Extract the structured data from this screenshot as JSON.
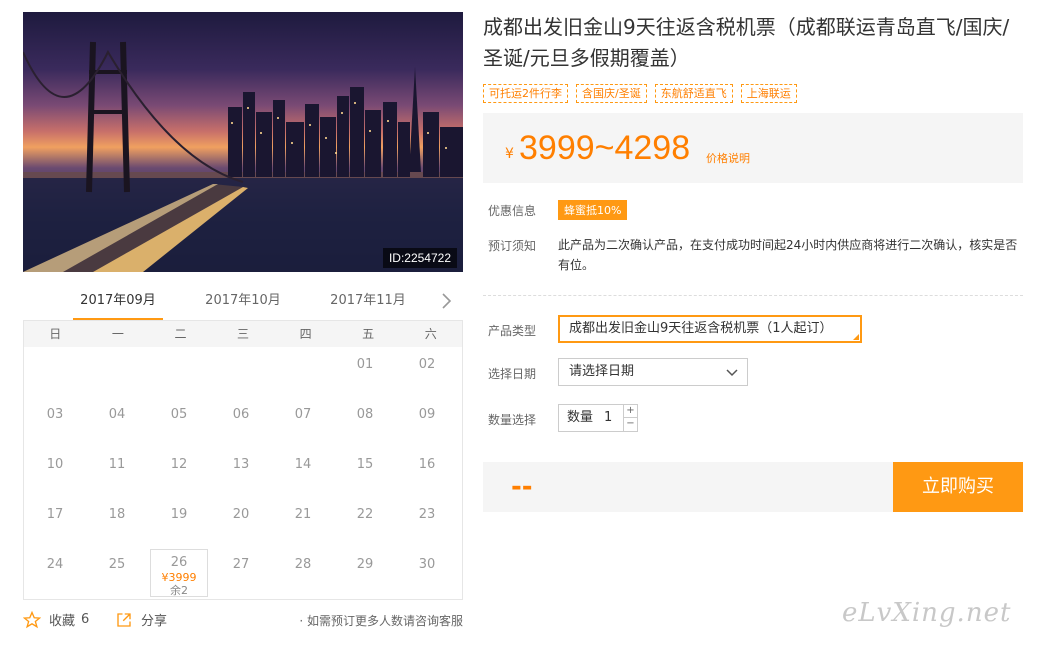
{
  "product": {
    "id_badge": "ID:2254722",
    "title": "成都出发旧金山9天往返含税机票（成都联运青岛直飞/国庆/圣诞/元旦多假期覆盖）",
    "tags": [
      "可托运2件行李",
      "含国庆/圣诞",
      "东航舒适直飞",
      "上海联运"
    ],
    "price": {
      "currency": "¥",
      "range": "3999~4298",
      "explain_link": "价格说明"
    },
    "promo": {
      "label": "优惠信息",
      "badge": "蜂蜜抵10%"
    },
    "notice": {
      "label": "预订须知",
      "text": "此产品为二次确认产品，在支付成功时间起24小时内供应商将进行二次确认，核实是否有位。"
    },
    "type": {
      "label": "产品类型",
      "value": "成都出发旧金山9天往返含税机票（1人起订）"
    },
    "date": {
      "label": "选择日期",
      "placeholder": "请选择日期"
    },
    "quantity": {
      "label": "数量选择",
      "prefix": "数量",
      "value": "1",
      "plus": "+",
      "minus": "−"
    },
    "total": "--",
    "buy_label": "立即购买"
  },
  "calendar": {
    "months": [
      "2017年09月",
      "2017年10月",
      "2017年11月"
    ],
    "active_month": 0,
    "weekdays": [
      "日",
      "一",
      "二",
      "三",
      "四",
      "五",
      "六"
    ],
    "first_weekday": 5,
    "days": 30,
    "available": [
      {
        "day": "26",
        "price": "¥3999",
        "remain": "余2"
      }
    ]
  },
  "footer": {
    "favorite_label": "收藏",
    "favorite_count": "6",
    "share_label": "分享",
    "consult_text": "· 如需预订更多人数请咨询客服"
  },
  "watermark": "eLvXing.net",
  "colors": {
    "accent": "#ff9913",
    "price": "#ff7f00"
  }
}
